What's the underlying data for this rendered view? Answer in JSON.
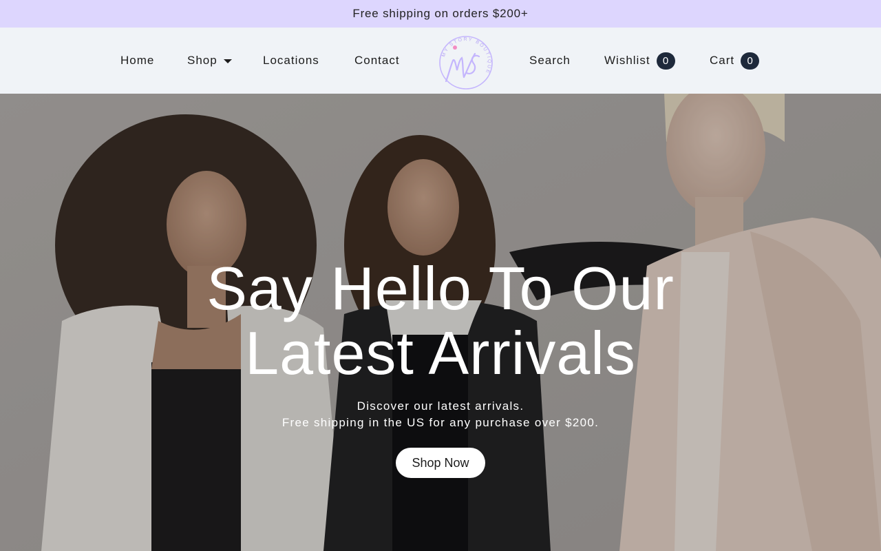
{
  "announcement": "Free shipping on orders $200+",
  "nav": {
    "home": "Home",
    "shop": "Shop",
    "locations": "Locations",
    "contact": "Contact",
    "search": "Search",
    "wishlist": "Wishlist",
    "wishlist_count": "0",
    "cart": "Cart",
    "cart_count": "0"
  },
  "logo": {
    "monogram": "MS",
    "ring_text": "MY STORY BOUTIQUE",
    "color": "#c4b5fd"
  },
  "hero": {
    "title": "Say Hello To Our\nLatest Arrivals",
    "subtitle_line1": "Discover our latest arrivals.",
    "subtitle_line2": "Free shipping in the US for any purchase over $200.",
    "cta": "Shop Now"
  },
  "colors": {
    "announcement_bg": "#ddd6fe",
    "header_bg": "#f0f3f7",
    "badge_bg": "#1e293b",
    "accent": "#c4b5fd"
  }
}
